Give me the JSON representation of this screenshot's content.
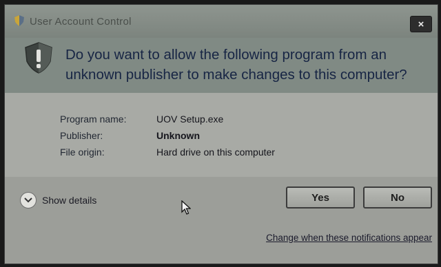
{
  "window": {
    "title": "User Account Control",
    "close_label": "×"
  },
  "header": {
    "question": "Do you want to allow the following program from an unknown publisher to make changes to this computer?"
  },
  "details": [
    {
      "label": "Program name:",
      "value": "UOV Setup.exe",
      "bold": false
    },
    {
      "label": "Publisher:",
      "value": "Unknown",
      "bold": true
    },
    {
      "label": "File origin:",
      "value": "Hard drive on this computer",
      "bold": false
    }
  ],
  "footer": {
    "show_details_label": "Show details",
    "yes_label": "Yes",
    "no_label": "No",
    "change_link": "Change when these notifications appear"
  },
  "icons": {
    "title_icon": "uac-shield-icon",
    "header_icon": "warning-shield-icon",
    "expander_icon": "chevron-down-icon",
    "pointer": "mouse-cursor-icon"
  },
  "colors": {
    "header_text": "#172544",
    "dialog_bg": "#a9aaa5",
    "header_bg": "#808a84"
  }
}
